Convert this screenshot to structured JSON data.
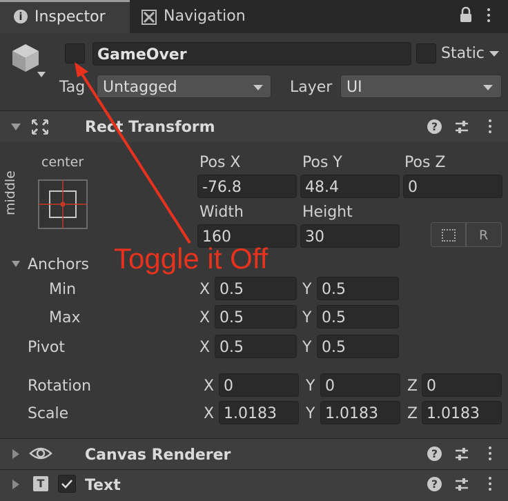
{
  "tabs": {
    "inspector": "Inspector",
    "navigation": "Navigation"
  },
  "object": {
    "name": "GameOver",
    "static_label": "Static",
    "tag_label": "Tag",
    "tag_value": "Untagged",
    "layer_label": "Layer",
    "layer_value": "UI",
    "active": false
  },
  "rect_transform": {
    "title": "Rect Transform",
    "anchor_h": "center",
    "anchor_v": "middle",
    "pos_x_label": "Pos X",
    "pos_y_label": "Pos Y",
    "pos_z_label": "Pos Z",
    "pos_x": "-76.8",
    "pos_y": "48.4",
    "pos_z": "0",
    "width_label": "Width",
    "height_label": "Height",
    "width": "160",
    "height": "30",
    "r_button": "R",
    "anchors_label": "Anchors",
    "min_label": "Min",
    "max_label": "Max",
    "min_x": "0.5",
    "min_y": "0.5",
    "max_x": "0.5",
    "max_y": "0.5",
    "pivot_label": "Pivot",
    "pivot_x": "0.5",
    "pivot_y": "0.5",
    "rotation_label": "Rotation",
    "rot_x": "0",
    "rot_y": "0",
    "rot_z": "0",
    "scale_label": "Scale",
    "scale_x": "1.0183",
    "scale_y": "1.0183",
    "scale_z": "1.0183",
    "axis_x": "X",
    "axis_y": "Y",
    "axis_z": "Z"
  },
  "components": {
    "canvas_renderer": "Canvas Renderer",
    "text": "Text",
    "text_icon": "T",
    "help": "?"
  },
  "annotation": {
    "text": "Toggle it Off",
    "color": "#e8321e"
  },
  "colors": {
    "panel": "#383838",
    "header": "#3e3e3e",
    "field": "#2a2a2a",
    "accent": "#e8321e"
  }
}
